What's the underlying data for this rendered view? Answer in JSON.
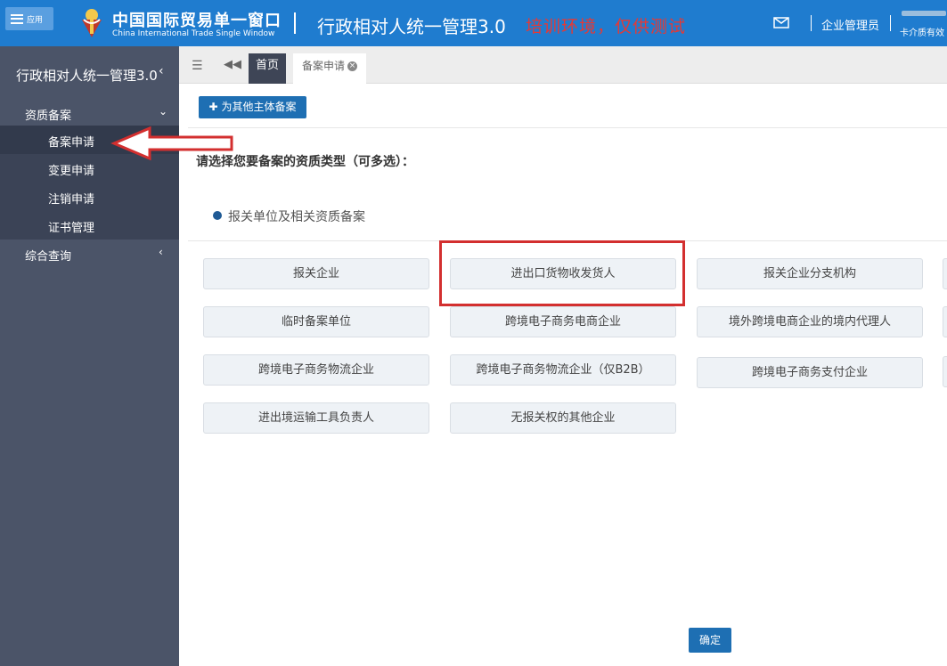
{
  "header": {
    "app_menu_label": "应用",
    "brand_cn": "中国国际贸易单一窗口",
    "brand_en": "China International Trade Single Window",
    "system_title": "行政相对人统一管理3.0",
    "env_note": "培训环境，仅供测试",
    "user_role": "企业管理员",
    "user_name": "卡介质有效"
  },
  "sidebar": {
    "title": "行政相对人统一管理3.0",
    "groups": [
      {
        "label": "资质备案",
        "items": [
          {
            "label": "备案申请"
          },
          {
            "label": "变更申请"
          },
          {
            "label": "注销申请"
          },
          {
            "label": "证书管理"
          }
        ]
      },
      {
        "label": "综合查询",
        "items": []
      }
    ]
  },
  "tabs": {
    "home": "首页",
    "current": "备案申请"
  },
  "main": {
    "other_entity_button": "为其他主体备案",
    "prompt": "请选择您要备案的资质类型（可多选）：",
    "section_title": "报关单位及相关资质备案",
    "types": [
      "报关企业",
      "进出口货物收发货人",
      "报关企业分支机构",
      "临时备案单位",
      "跨境电子商务电商企业",
      "境外跨境电商企业的境内代理人",
      "跨境电子商务物流企业",
      "跨境电子商务物流企业（仅B2B）",
      "跨境电子商务支付企业",
      "进出境运输工具负责人",
      "无报关权的其他企业"
    ],
    "confirm_button": "确定"
  },
  "colors": {
    "header_bg": "#1f7ccf",
    "sidebar_bg": "#4b5468",
    "primary_button": "#1e6fb3",
    "annotation_red": "#d32f2f"
  }
}
